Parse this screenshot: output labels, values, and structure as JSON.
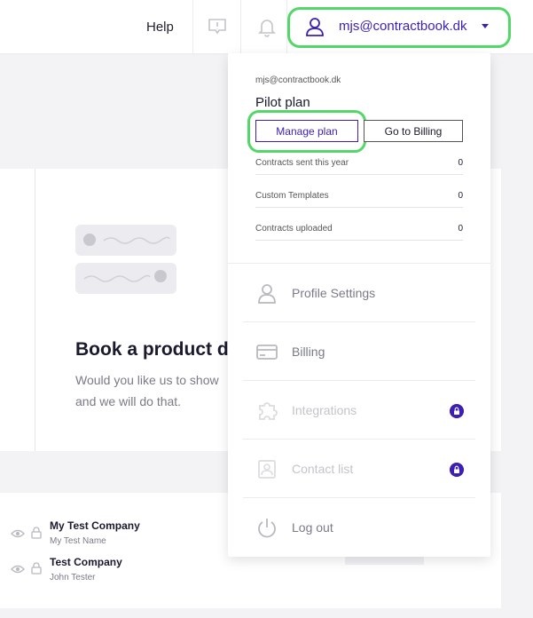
{
  "topbar": {
    "help": "Help",
    "user_email": "mjs@contractbook.dk"
  },
  "background": {
    "demo_title": "Book a product d",
    "demo_text_line1": "Would you like us to show",
    "demo_text_line2": "and we will do that.",
    "rows": [
      {
        "title": "My Test Company",
        "subtitle": "My Test Name"
      },
      {
        "title": "Test Company",
        "subtitle": "John Tester"
      }
    ]
  },
  "dropdown": {
    "email": "mjs@contractbook.dk",
    "plan": "Pilot plan",
    "manage_plan": "Manage plan",
    "go_to_billing": "Go to Billing",
    "stats": [
      {
        "label": "Contracts sent this year",
        "value": "0"
      },
      {
        "label": "Custom Templates",
        "value": "0"
      },
      {
        "label": "Contracts uploaded",
        "value": "0"
      }
    ],
    "menu": [
      {
        "label": "Profile Settings",
        "icon": "person-icon",
        "locked": false
      },
      {
        "label": "Billing",
        "icon": "credit-card-icon",
        "locked": false
      },
      {
        "label": "Integrations",
        "icon": "puzzle-icon",
        "locked": true
      },
      {
        "label": "Contact list",
        "icon": "contact-card-icon",
        "locked": true
      },
      {
        "label": "Log out",
        "icon": "power-icon",
        "locked": false
      }
    ]
  },
  "colors": {
    "accent": "#3d1fb5",
    "highlight": "#53d769",
    "text_muted": "#7a7a88",
    "text_disabled": "#c4c4ca"
  }
}
